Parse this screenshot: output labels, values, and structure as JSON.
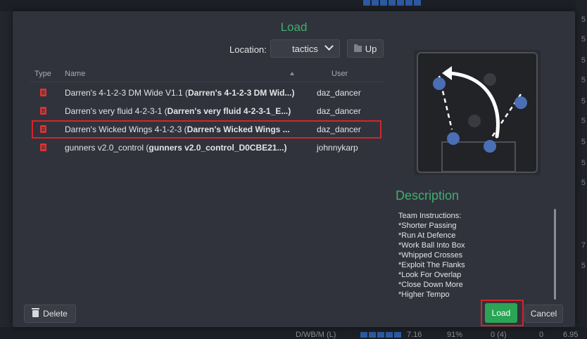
{
  "background": {
    "right_numbers": [
      "5",
      "5",
      "5",
      "5",
      "5",
      "5",
      "5",
      "5",
      "5",
      "7",
      "5"
    ],
    "bottom_text": [
      "D/WB/M (L)",
      "7.16",
      "91%",
      "0 (4)",
      "0",
      "6.95"
    ]
  },
  "dialog": {
    "title": "Load",
    "location_label": "Location:",
    "location_value": "tactics",
    "up_label": "Up"
  },
  "table": {
    "headers": {
      "type": "Type",
      "name": "Name",
      "user": "User"
    },
    "rows": [
      {
        "name_plain": "Darren's 4-1-2-3 DM Wide V1.1 (",
        "name_bold": "Darren's 4-1-2-3 DM Wid...)",
        "user": "daz_dancer"
      },
      {
        "name_plain": "Darren's very fluid 4-2-3-1 (",
        "name_bold": "Darren's very fluid 4-2-3-1_E...)",
        "user": "daz_dancer"
      },
      {
        "name_plain": "Darren's Wicked Wings 4-1-2-3  (",
        "name_bold": "Darren's Wicked Wings ...",
        "user": "daz_dancer"
      },
      {
        "name_plain": "gunners v2.0_control (",
        "name_bold": "gunners v2.0_control_D0CBE21...)",
        "user": "johnnykarp"
      }
    ],
    "selected_index": 2
  },
  "preview": {
    "icon": "tactics-pitch-icon",
    "accent": "#4a6fb5"
  },
  "description": {
    "title": "Description",
    "lines": [
      "Team Instructions:",
      "*Shorter Passing",
      "*Run At Defence",
      "*Work Ball Into Box",
      "*Whipped Crosses",
      "*Exploit The Flanks",
      "*Look For Overlap",
      "*Close Down More",
      "*Higher Tempo"
    ]
  },
  "buttons": {
    "delete_label": "Delete",
    "load_label": "Load",
    "cancel_label": "Cancel"
  },
  "colors": {
    "accent_green": "#3fae6f",
    "load_green": "#2ba456",
    "highlight_red": "#d8232a",
    "file_icon_red": "#dd3333"
  }
}
